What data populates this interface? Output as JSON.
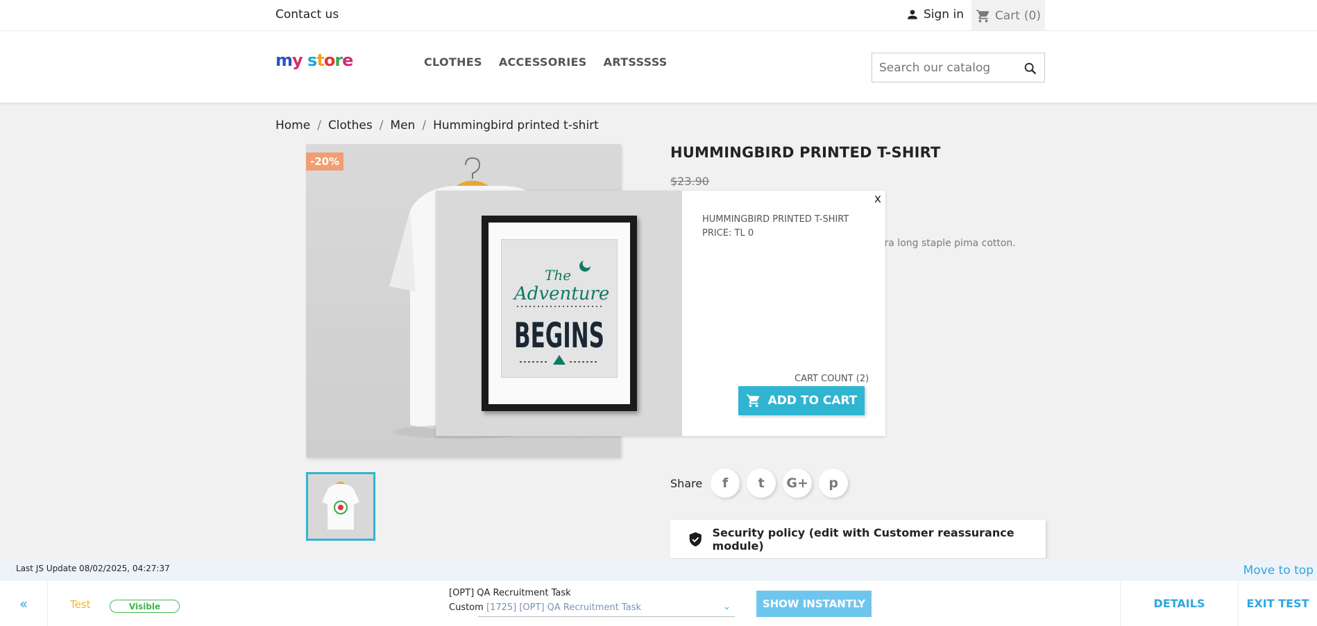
{
  "topbar": {
    "contact": "Contact us",
    "signin": "Sign in",
    "cart": "Cart",
    "cart_count": "(0)"
  },
  "header": {
    "logo": "my store",
    "nav": [
      "CLOTHES",
      "ACCESSORIES",
      "ARTSSSSS"
    ],
    "search_placeholder": "Search our catalog"
  },
  "breadcrumb": [
    "Home",
    "Clothes",
    "Men",
    "Hummingbird printed t-shirt"
  ],
  "product": {
    "discount": "-20%",
    "title": "HUMMINGBIRD PRINTED T-SHIRT",
    "old_price": "$23.90",
    "description_fragment": "f extra long staple pima cotton.",
    "share_label": "Share",
    "share_icons": [
      "facebook-icon",
      "twitter-icon",
      "google-plus-icon",
      "pinterest-icon"
    ],
    "share_glyphs": [
      "f",
      "t",
      "G+",
      "p"
    ],
    "reassurance": "Security policy (edit with Customer reassurance module)"
  },
  "popup": {
    "close": "x",
    "name": "HUMMINGBIRD PRINTED T-SHIRT",
    "price": "PRICE: TL 0",
    "cart_count": "CART COUNT (2)",
    "add_to_cart": "ADD TO CART",
    "art_line1": "The",
    "art_line2": "Adventure",
    "art_line3": "BEGINS"
  },
  "testtool": {
    "js_update": "Last JS Update 08/02/2025, 04:27:37",
    "move_to_top": "Move to top",
    "back": "«",
    "test_name": "Test",
    "status": "Visible",
    "task": "[OPT] QA Recruitment Task",
    "custom_label": "Custom",
    "select_value": "[1725] [OPT] QA Recruitment Task",
    "show_instantly": "SHOW INSTANTLY",
    "details": "DETAILS",
    "exit": "EXIT TEST"
  },
  "colors": {
    "accent": "#2fb5d2",
    "discount": "#f39d72",
    "tool_blue": "#2fa6de"
  }
}
